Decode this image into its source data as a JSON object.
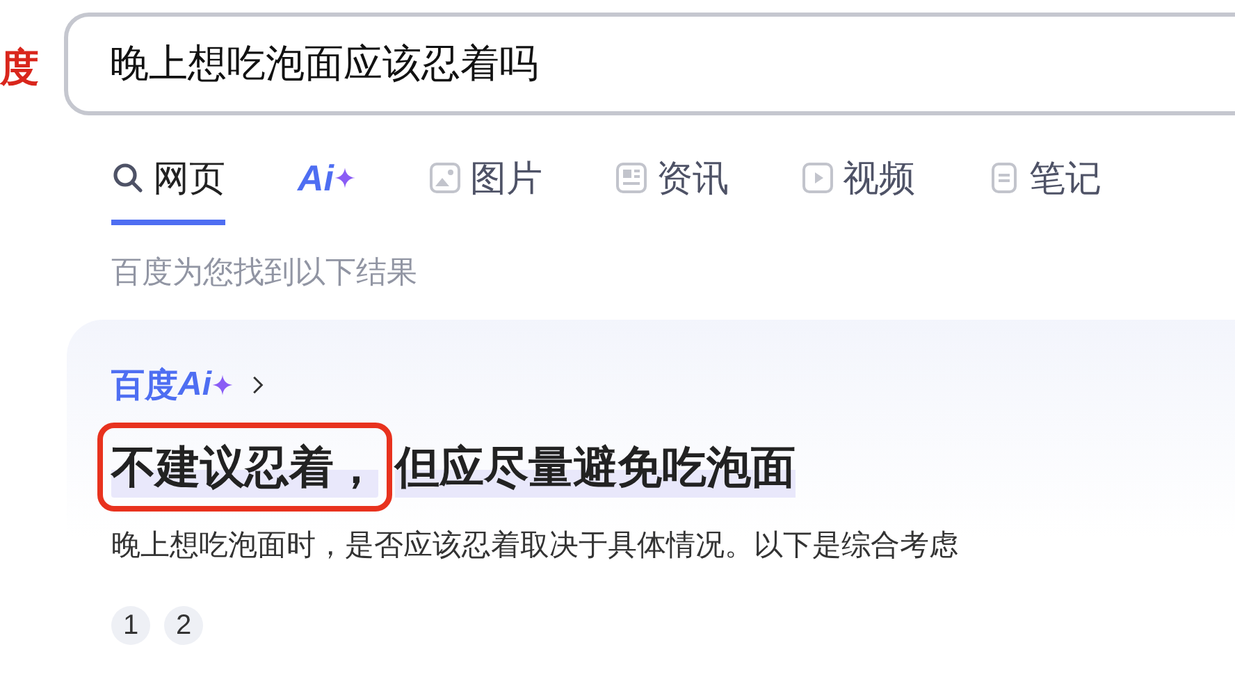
{
  "logo_fragment": "度",
  "search": {
    "value": "晚上想吃泡面应该忍着吗"
  },
  "tabs": [
    {
      "kind": "search",
      "label": "网页",
      "selected": true
    },
    {
      "kind": "ai",
      "label": "Ai",
      "selected": false
    },
    {
      "kind": "image",
      "label": "图片",
      "selected": false
    },
    {
      "kind": "news",
      "label": "资讯",
      "selected": false
    },
    {
      "kind": "video",
      "label": "视频",
      "selected": false
    },
    {
      "kind": "note",
      "label": "笔记",
      "selected": false
    }
  ],
  "result_count": "百度为您找到以下结果",
  "ai_card": {
    "brand": "百度",
    "brand_ai": "Ai",
    "headline": [
      {
        "text": "不建议忍着，",
        "annotated": true
      },
      {
        "text": "但应尽量避免吃泡面",
        "annotated": false
      }
    ],
    "body": "晚上想吃泡面时，是否应该忍着取决于具体情况。以下是综合考虑",
    "citations": [
      "1",
      "2"
    ]
  }
}
